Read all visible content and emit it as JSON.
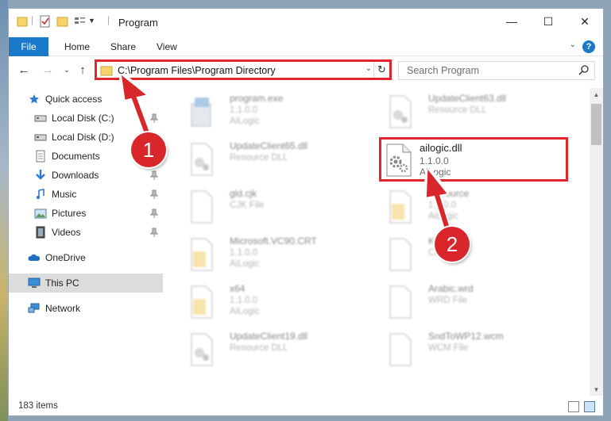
{
  "window": {
    "title": "Program",
    "controls": {
      "minimize": "—",
      "maximize": "☐",
      "close": "✕"
    }
  },
  "ribbon": {
    "tabs": [
      "File",
      "Home",
      "Share",
      "View"
    ],
    "help": "?"
  },
  "nav": {
    "address": "C:\\Program Files\\Program Directory",
    "search_placeholder": "Search Program"
  },
  "sidebar": {
    "items": [
      {
        "label": "Quick access",
        "icon": "star-icon"
      },
      {
        "label": "Local Disk (C:)",
        "icon": "drive-icon",
        "pinned": true
      },
      {
        "label": "Local Disk (D:)",
        "icon": "drive-icon",
        "pinned": true
      },
      {
        "label": "Documents",
        "icon": "document-icon",
        "pinned": true
      },
      {
        "label": "Downloads",
        "icon": "download-icon",
        "pinned": true
      },
      {
        "label": "Music",
        "icon": "music-icon",
        "pinned": true
      },
      {
        "label": "Pictures",
        "icon": "picture-icon",
        "pinned": true
      },
      {
        "label": "Videos",
        "icon": "video-icon",
        "pinned": true
      },
      {
        "label": "OneDrive",
        "icon": "cloud-icon"
      },
      {
        "label": "This PC",
        "icon": "computer-icon",
        "selected": true
      },
      {
        "label": "Network",
        "icon": "network-icon"
      }
    ]
  },
  "files": [
    {
      "name": "program.exe",
      "line2": "1.1.0.0",
      "line3": "AiLogic",
      "icon": "exe-icon"
    },
    {
      "name": "UpdateClient63.dll",
      "line2": "Resource DLL",
      "line3": "",
      "icon": "dll-icon"
    },
    {
      "name": "UpdateClient65.dll",
      "line2": "Resource DLL",
      "line3": "",
      "icon": "dll-icon"
    },
    {
      "name": "gld.cjk",
      "line2": "CJK File",
      "line3": "",
      "icon": "blank-file-icon"
    },
    {
      "name": "Resource",
      "line2": "1.1.0.0",
      "line3": "AiLogic",
      "icon": "folder-file-icon"
    },
    {
      "name": "Microsoft.VC90.CRT",
      "line2": "1.1.0.0",
      "line3": "AiLogic",
      "icon": "folder-file-icon"
    },
    {
      "name": "Kor",
      "line2": "CK File",
      "line3": "",
      "icon": "blank-file-icon"
    },
    {
      "name": "x64",
      "line2": "1.1.0.0",
      "line3": "AiLogic",
      "icon": "folder-file-icon"
    },
    {
      "name": "Arabic.wrd",
      "line2": "WRD File",
      "line3": "",
      "icon": "blank-file-icon"
    },
    {
      "name": "UpdateClient19.dll",
      "line2": "Resource DLL",
      "line3": "",
      "icon": "dll-icon"
    },
    {
      "name": "SndToWP12.wcm",
      "line2": "WCM File",
      "line3": "",
      "icon": "blank-file-icon"
    }
  ],
  "highlighted_file": {
    "name": "ailogic.dll",
    "line2": "1.1.0.0",
    "line3": "AiLogic",
    "icon": "dll-icon"
  },
  "annotations": {
    "step1": "1",
    "step2": "2",
    "color": "#d9262b"
  },
  "status": {
    "items": "183 items"
  }
}
